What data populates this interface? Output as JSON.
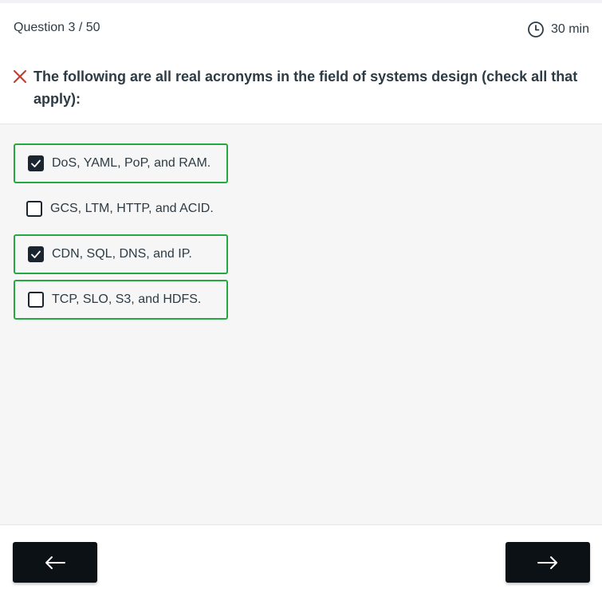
{
  "header": {
    "question_counter": "Question 3 / 50",
    "timer": {
      "icon": "clock-icon",
      "text": "30 min"
    }
  },
  "question": {
    "status_icon": "close-icon",
    "status_color": "#c0392b",
    "text": "The following are all real acronyms in the field of systems design (check all that apply):"
  },
  "options": [
    {
      "label": "DoS, YAML, PoP, and RAM.",
      "checked": true,
      "highlighted": true
    },
    {
      "label": "GCS, LTM, HTTP, and ACID.",
      "checked": false,
      "highlighted": false
    },
    {
      "label": "CDN, SQL, DNS, and IP.",
      "checked": true,
      "highlighted": true
    },
    {
      "label": "TCP, SLO, S3, and HDFS.",
      "checked": false,
      "highlighted": true
    }
  ],
  "colors": {
    "correct_border": "#26a742",
    "checkbox_fill": "#1b2530",
    "nav_button": "#0c1116"
  },
  "footer": {
    "prev_icon": "arrow-left-icon",
    "next_icon": "arrow-right-icon"
  }
}
